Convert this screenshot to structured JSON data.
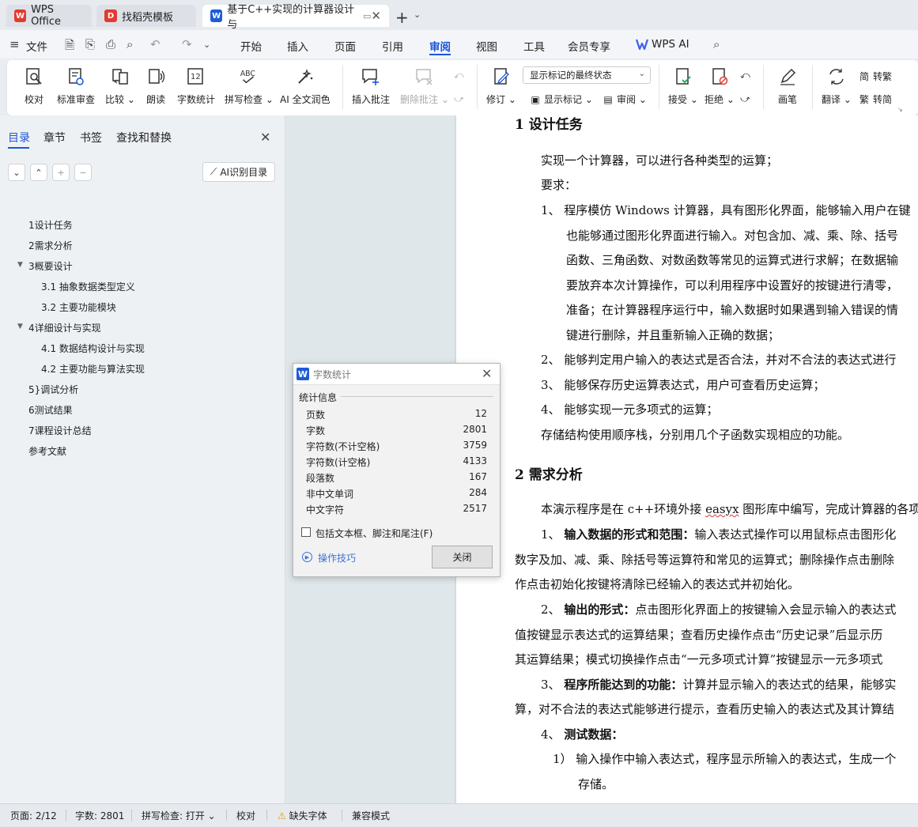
{
  "tabs": [
    {
      "label": "WPS Office",
      "logo": "W"
    },
    {
      "label": "找稻壳模板",
      "logo": "D"
    },
    {
      "label": "基于C++实现的计算器设计与",
      "logo": "W"
    }
  ],
  "menu": {
    "file": "文件",
    "items": [
      "开始",
      "插入",
      "页面",
      "引用",
      "审阅",
      "视图",
      "工具",
      "会员专享"
    ],
    "active": "审阅",
    "ai": "WPS AI"
  },
  "ribbon": {
    "proofread": "校对",
    "standard_review": "标准审查",
    "compare": "比较",
    "read_aloud": "朗读",
    "word_count": "字数统计",
    "word_count_icon_text": "12",
    "spell_check": "拼写检查",
    "spell_check_icon_text": "ABC",
    "ai_polish": "AI 全文润色",
    "insert_comment": "插入批注",
    "delete_comment": "删除批注",
    "track_changes": "修订",
    "markup_select": "显示标记的最终状态",
    "show_markup": "显示标记",
    "review_pane": "审阅",
    "accept": "接受",
    "reject": "拒绝",
    "ink": "画笔",
    "translate": "翻译",
    "to_traditional": "转繁",
    "to_simplified": "转简"
  },
  "nav": {
    "tabs": [
      "目录",
      "章节",
      "书签",
      "查找和替换"
    ],
    "ai_toc": "AI识别目录",
    "toc": [
      {
        "label": "1设计任务",
        "level": 1,
        "arrow": false
      },
      {
        "label": "2需求分析",
        "level": 1,
        "arrow": false
      },
      {
        "label": "3概要设计",
        "level": 1,
        "arrow": true
      },
      {
        "label": "3.1 抽象数据类型定义",
        "level": 2,
        "arrow": false
      },
      {
        "label": "3.2  主要功能模块",
        "level": 2,
        "arrow": false
      },
      {
        "label": "4详细设计与实现",
        "level": 1,
        "arrow": true
      },
      {
        "label": "4.1  数据结构设计与实现",
        "level": 2,
        "arrow": false
      },
      {
        "label": "4.2  主要功能与算法实现",
        "level": 2,
        "arrow": false
      },
      {
        "label": "5}调试分析",
        "level": 1,
        "arrow": false
      },
      {
        "label": "6测试结果",
        "level": 1,
        "arrow": false
      },
      {
        "label": "7课程设计总结",
        "level": 1,
        "arrow": false
      },
      {
        "label": "参考文献",
        "level": 1,
        "arrow": false
      }
    ]
  },
  "doc": {
    "h1": "1  设计任务",
    "p1": "实现一个计算器，可以进行各种类型的运算；",
    "p2": "要求：",
    "l1a": "1、  程序模仿 Windows 计算器，具有图形化界面，能够输入用户在键",
    "l1b": "也能够通过图形化界面进行输入。对包含加、减、乘、除、括号",
    "l1c": "函数、三角函数、对数函数等常见的运算式进行求解；在数据输",
    "l1d": "要放弃本次计算操作，可以利用程序中设置好的按键进行清零，",
    "l1e": "准备；在计算器程序运行中，输入数据时如果遇到输入错误的情",
    "l1f": "键进行删除，并且重新输入正确的数据；",
    "l2": "2、  能够判定用户输入的表达式是否合法，并对不合法的表达式进行",
    "l3": "3、  能够保存历史运算表达式，用户可查看历史运算；",
    "l4": "4、  能够实现一元多项式的运算；",
    "p3": "存储结构使用顺序栈，分别用几个子函数实现相应的功能。",
    "h2": "2  需求分析",
    "p4_pre": "本演示程序是在 c++环境外接 ",
    "p4_ul": "easyx",
    "p4_post": " 图形库中编写，完成计算器的各项",
    "q1_num": "1、  ",
    "q1_bold": "输入数据的形式和范围：",
    "q1_rest": "输入表达式操作可以用鼠标点击图形化",
    "q1b": "数字及加、减、乘、除括号等运算符和常见的运算式；删除操作点击删除",
    "q1c": "作点击初始化按键将清除已经输入的表达式并初始化。",
    "q2_num": "2、  ",
    "q2_bold": "输出的形式：",
    "q2_rest": "点击图形化界面上的按键输入会显示输入的表达式",
    "q2b": "值按键显示表达式的运算结果；查看历史操作点击“历史记录”后显示历",
    "q2c": "其运算结果；模式切换操作点击“一元多项式计算”按键显示一元多项式",
    "q3_num": "3、  ",
    "q3_bold": "程序所能达到的功能：",
    "q3_rest": "计算并显示输入的表达式的结果，能够实",
    "q3b": "算，对不合法的表达式能够进行提示，查看历史输入的表达式及其计算结",
    "q4_num": "4、  ",
    "q4_bold": "测试数据：",
    "t1": "1）  输入操作中输入表达式，程序显示所输入的表达式，生成一个",
    "t1b": "存储。"
  },
  "dialog": {
    "title": "字数统计",
    "section": "统计信息",
    "stats": [
      {
        "label": "页数",
        "value": "12"
      },
      {
        "label": "字数",
        "value": "2801"
      },
      {
        "label": "字符数(不计空格)",
        "value": "3759"
      },
      {
        "label": "字符数(计空格)",
        "value": "4133"
      },
      {
        "label": "段落数",
        "value": "167"
      },
      {
        "label": "非中文单词",
        "value": "284"
      },
      {
        "label": "中文字符",
        "value": "2517"
      }
    ],
    "checkbox_label": "包括文本框、脚注和尾注(F)",
    "tips": "操作技巧",
    "close": "关闭"
  },
  "status": {
    "page": "页面: 2/12",
    "words": "字数: 2801",
    "spell": "拼写检查: 打开",
    "proof": "校对",
    "missing_font": "缺失字体",
    "compat": "兼容模式"
  },
  "colors": {
    "accent": "#1a56db",
    "wps_red": "#e33b2e",
    "wps_blue": "#1e5bd6"
  }
}
